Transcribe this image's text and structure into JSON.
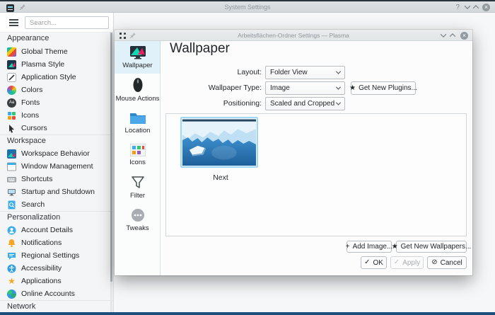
{
  "glyphs": {
    "help": "?",
    "close": "×",
    "star": "★",
    "plus": "+",
    "check": "✓",
    "cancel": "⊘",
    "fonts_sample": "Aa",
    "tweaks_dots": "•••"
  },
  "main_window": {
    "titlebar": {
      "title": "System Settings"
    },
    "toolbar": {
      "search_placeholder": "Search..."
    },
    "sidebar": {
      "sections": [
        {
          "header": "Appearance",
          "items": [
            {
              "label": "Global Theme"
            },
            {
              "label": "Plasma Style"
            },
            {
              "label": "Application Style"
            },
            {
              "label": "Colors"
            },
            {
              "label": "Fonts"
            },
            {
              "label": "Icons"
            },
            {
              "label": "Cursors"
            }
          ]
        },
        {
          "header": "Workspace",
          "items": [
            {
              "label": "Workspace Behavior"
            },
            {
              "label": "Window Management"
            },
            {
              "label": "Shortcuts"
            },
            {
              "label": "Startup and Shutdown"
            },
            {
              "label": "Search"
            }
          ]
        },
        {
          "header": "Personalization",
          "items": [
            {
              "label": "Account Details"
            },
            {
              "label": "Notifications"
            },
            {
              "label": "Regional Settings"
            },
            {
              "label": "Accessibility"
            },
            {
              "label": "Applications"
            },
            {
              "label": "Online Accounts"
            }
          ]
        },
        {
          "header": "Network",
          "items": []
        }
      ]
    }
  },
  "dialog": {
    "titlebar": {
      "title": "Arbeitsflächen-Ordner Settings — Plasma"
    },
    "tabs": [
      {
        "label": "Wallpaper"
      },
      {
        "label": "Mouse Actions"
      },
      {
        "label": "Location"
      },
      {
        "label": "Icons"
      },
      {
        "label": "Filter"
      },
      {
        "label": "Tweaks"
      }
    ],
    "heading": "Wallpaper",
    "form": {
      "layout_label": "Layout:",
      "layout_value": "Folder View",
      "type_label": "Wallpaper Type:",
      "type_value": "Image",
      "plugins_button": "Get New Plugins...",
      "positioning_label": "Positioning:",
      "positioning_value": "Scaled and Cropped"
    },
    "wallpapers": [
      {
        "name": "Next"
      }
    ],
    "buttons": {
      "add_image": "Add Image...",
      "get_new_wallpapers": "Get New Wallpapers...",
      "ok": "OK",
      "apply": "Apply",
      "cancel": "Cancel"
    }
  }
}
